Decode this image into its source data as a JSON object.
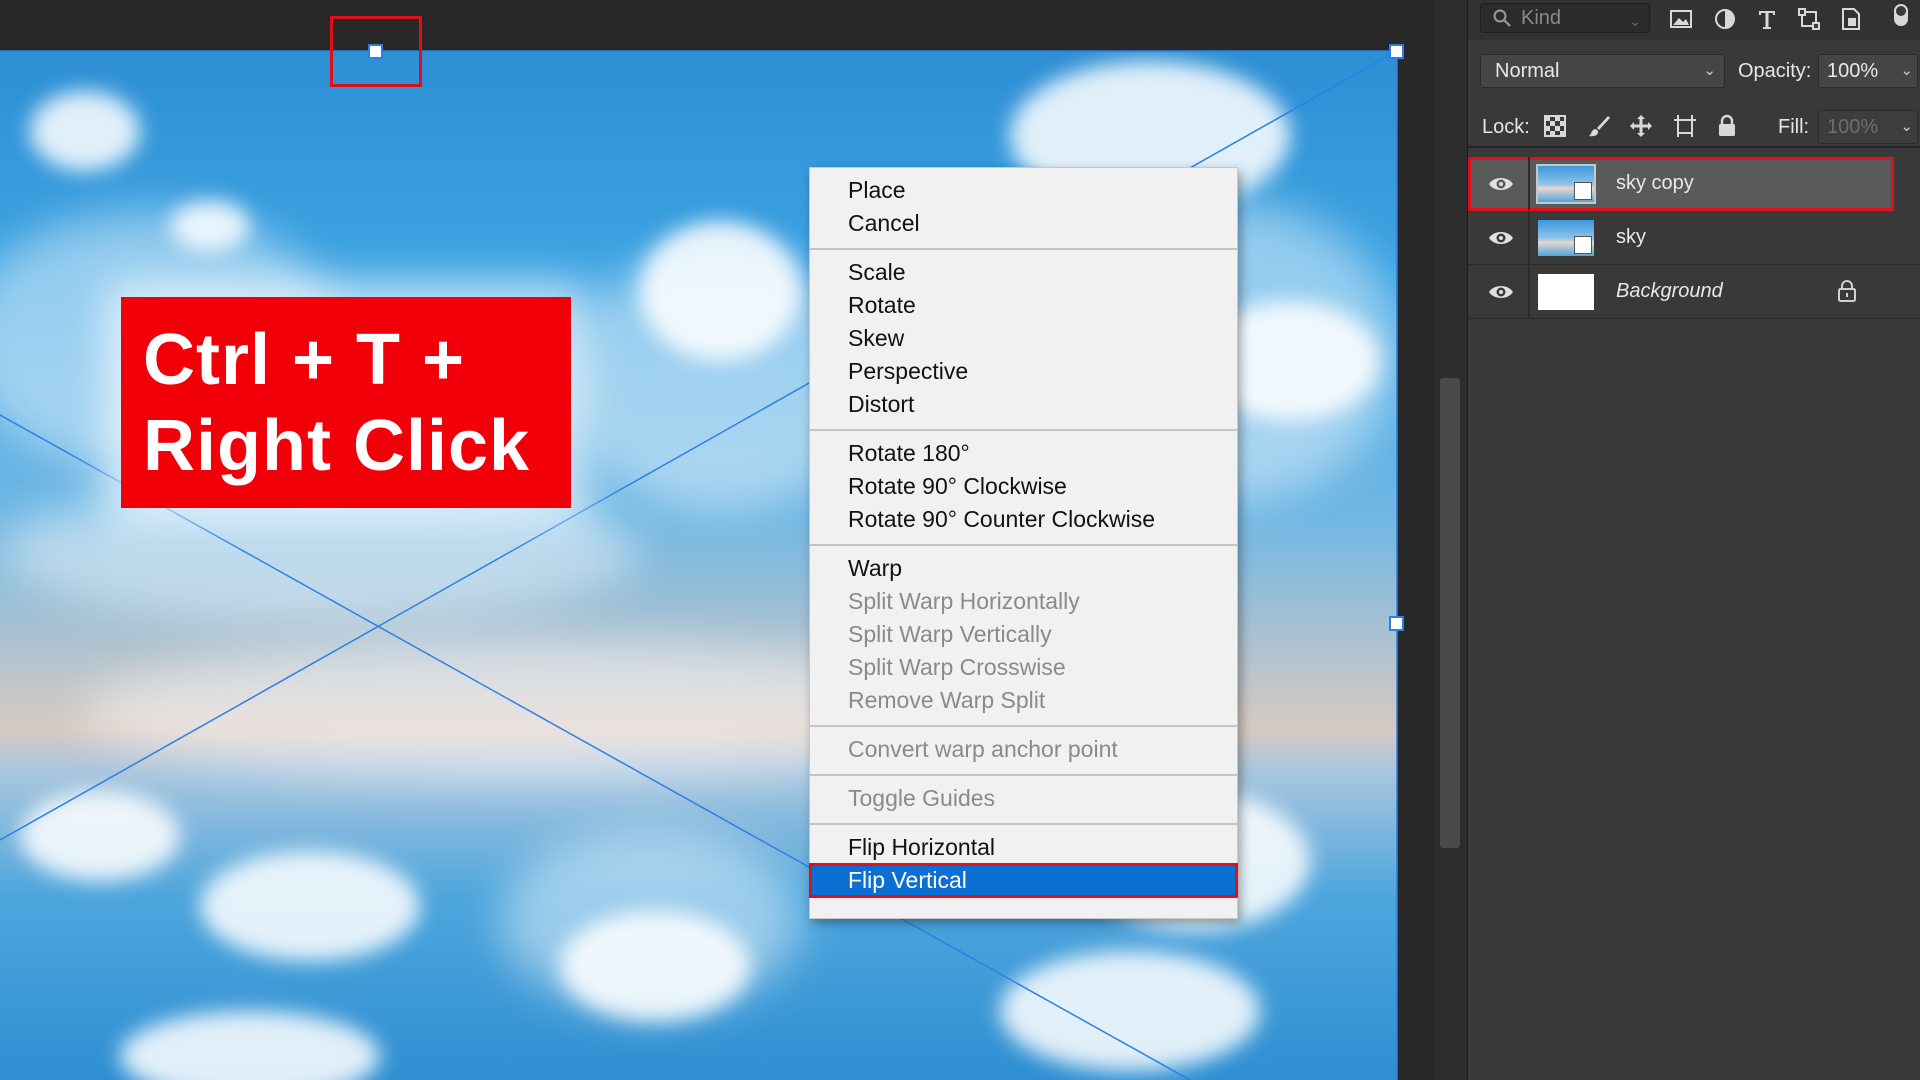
{
  "overlay": {
    "line1": "Ctrl + T +",
    "line2": "Right Click"
  },
  "context_menu": {
    "groups": [
      [
        {
          "label": "Place",
          "enabled": true
        },
        {
          "label": "Cancel",
          "enabled": true
        }
      ],
      [
        {
          "label": "Scale",
          "enabled": true
        },
        {
          "label": "Rotate",
          "enabled": true
        },
        {
          "label": "Skew",
          "enabled": true
        },
        {
          "label": "Perspective",
          "enabled": true
        },
        {
          "label": "Distort",
          "enabled": true
        }
      ],
      [
        {
          "label": "Rotate 180°",
          "enabled": true
        },
        {
          "label": "Rotate 90° Clockwise",
          "enabled": true
        },
        {
          "label": "Rotate 90° Counter Clockwise",
          "enabled": true
        }
      ],
      [
        {
          "label": "Warp",
          "enabled": true
        },
        {
          "label": "Split Warp Horizontally",
          "enabled": false
        },
        {
          "label": "Split Warp Vertically",
          "enabled": false
        },
        {
          "label": "Split Warp Crosswise",
          "enabled": false
        },
        {
          "label": "Remove Warp Split",
          "enabled": false
        }
      ],
      [
        {
          "label": "Convert warp anchor point",
          "enabled": false
        }
      ],
      [
        {
          "label": "Toggle Guides",
          "enabled": false
        }
      ],
      [
        {
          "label": "Flip Horizontal",
          "enabled": true
        },
        {
          "label": "Flip Vertical",
          "enabled": true,
          "selected": true
        }
      ]
    ]
  },
  "layers_panel": {
    "filter_kind_placeholder": "Kind",
    "filter_icons": [
      "image-filter-icon",
      "adjustment-filter-icon",
      "type-filter-icon",
      "shape-filter-icon",
      "smart-object-filter-icon"
    ],
    "blend_mode": "Normal",
    "opacity_label": "Opacity:",
    "opacity_value": "100%",
    "lock_label": "Lock:",
    "lock_icons": [
      "lock-transparent-pixels-icon",
      "lock-image-pixels-icon",
      "lock-position-icon",
      "lock-artboard-icon",
      "lock-all-icon"
    ],
    "fill_label": "Fill:",
    "fill_value": "100%",
    "layers": [
      {
        "name": "sky copy",
        "type": "smart-object",
        "visible": true,
        "active": true
      },
      {
        "name": "sky",
        "type": "smart-object",
        "visible": true,
        "active": false
      },
      {
        "name": "Background",
        "type": "background",
        "visible": true,
        "active": false,
        "locked": true
      }
    ]
  },
  "colors": {
    "menu_highlight": "#0c6fd4",
    "annotation_red": "#e0101a",
    "overlay_red": "#f20009",
    "transform_line": "#2d7fe6"
  }
}
